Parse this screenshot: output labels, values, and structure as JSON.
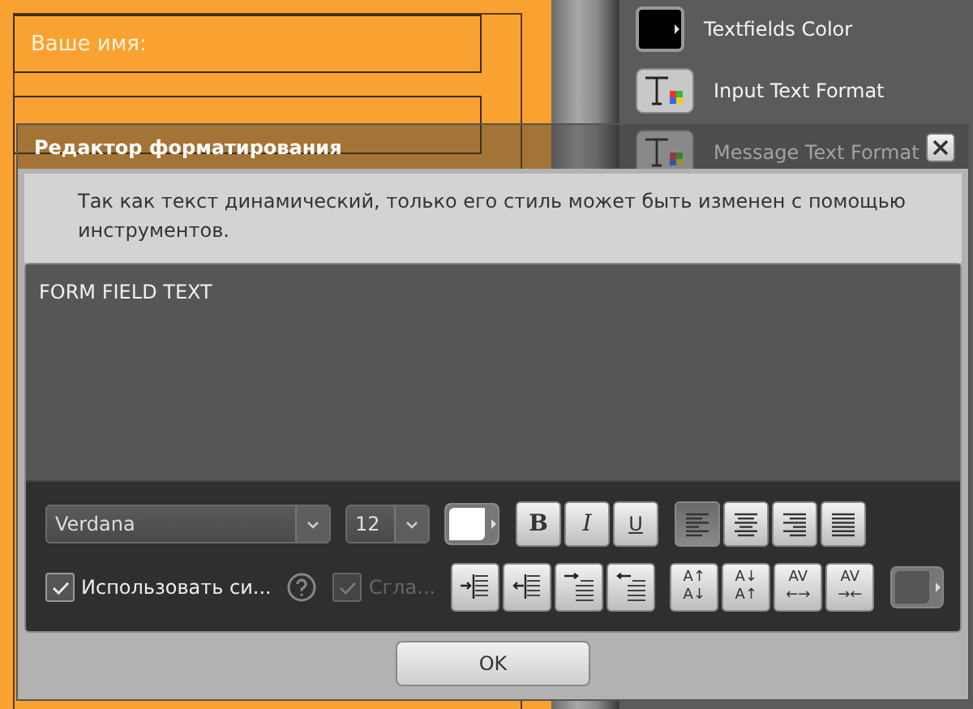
{
  "background": {
    "form_fields": [
      {
        "label": "Ваше имя:"
      }
    ],
    "panel_items": [
      {
        "label": "Textfields Color",
        "kind": "swatch"
      },
      {
        "label": "Input Text Format",
        "kind": "text-format"
      },
      {
        "label": "Message Text Format",
        "kind": "text-format"
      }
    ]
  },
  "dialog": {
    "title": "Редактор форматирования",
    "message": "Так как текст динамический, только его стиль может быть изменен с помощью инструментов.",
    "text_area": {
      "value": "FORM FIELD TEXT"
    },
    "font": {
      "value": "Verdana"
    },
    "size": {
      "value": "12"
    },
    "style_buttons": [
      {
        "label": "B",
        "kind": "bold"
      },
      {
        "label": "I",
        "kind": "italic"
      },
      {
        "label": "U",
        "kind": "underline"
      }
    ],
    "align_buttons": [
      {
        "kind": "left",
        "selected": true
      },
      {
        "kind": "center",
        "selected": false
      },
      {
        "kind": "right",
        "selected": false
      },
      {
        "kind": "justify",
        "selected": false
      }
    ],
    "options": [
      {
        "label": "Использовать си...",
        "checked": true,
        "disabled": false,
        "has_help": true
      },
      {
        "label": "Сгла...",
        "checked": true,
        "disabled": true,
        "has_help": false
      }
    ],
    "indent_buttons": [
      {
        "kind": "indent"
      },
      {
        "kind": "outdent"
      },
      {
        "kind": "first-indent"
      },
      {
        "kind": "first-outdent"
      }
    ],
    "spacing_buttons": [
      {
        "top": "A↑",
        "bottom": "A↓"
      },
      {
        "top": "A↓",
        "bottom": "A↑"
      },
      {
        "top": "AV",
        "bottom": "←→"
      },
      {
        "top": "AV",
        "bottom": "→←"
      }
    ],
    "ok": "OK"
  }
}
